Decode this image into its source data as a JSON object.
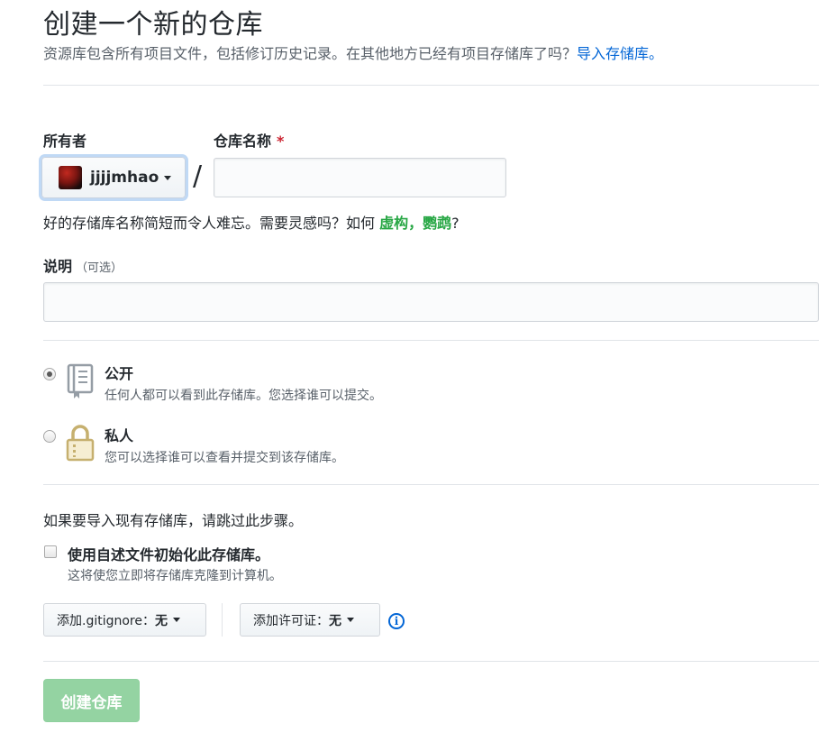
{
  "header": {
    "title": "创建一个新的仓库",
    "subtitle": "资源库包含所有项目文件，包括修订历史记录。在其他地方已经有项目存储库了吗？",
    "import_link": "导入存储库。"
  },
  "form": {
    "owner_label": "所有者",
    "repo_name_label": "仓库名称",
    "required_mark": "*",
    "owner_value": "jjjjmhao",
    "separator": "/",
    "repo_name_value": "",
    "hint_prefix": "好的存储库名称简短而令人难忘。需要灵感吗？如何 ",
    "hint_suggestion": "虚构，鹦鹉",
    "hint_suffix": "?",
    "description_label": "说明",
    "description_optional": "（可选）",
    "description_value": ""
  },
  "visibility": {
    "selected": "public",
    "public_title": "公开",
    "public_desc": "任何人都可以看到此存储库。您选择谁可以提交。",
    "private_title": "私人",
    "private_desc": "您可以选择谁可以查看并提交到该存储库。"
  },
  "init": {
    "skip_note": "如果要导入现有存储库，请跳过此步骤。",
    "readme_label": "使用自述文件初始化此存储库。",
    "readme_desc": "这将使您立即将存储库克隆到计算机。",
    "readme_checked": false,
    "gitignore_label": "添加.gitignore：",
    "gitignore_value": "无",
    "license_label": "添加许可证：",
    "license_value": "无",
    "info_glyph": "i"
  },
  "submit": {
    "label": "创建仓库"
  },
  "colors": {
    "link": "#0366d6",
    "suggestion": "#28a745",
    "required": "#cb2431",
    "create_button": "#94d3a2"
  },
  "icons": [
    "repo-book-icon",
    "lock-icon",
    "caret-down-icon",
    "info-icon"
  ]
}
